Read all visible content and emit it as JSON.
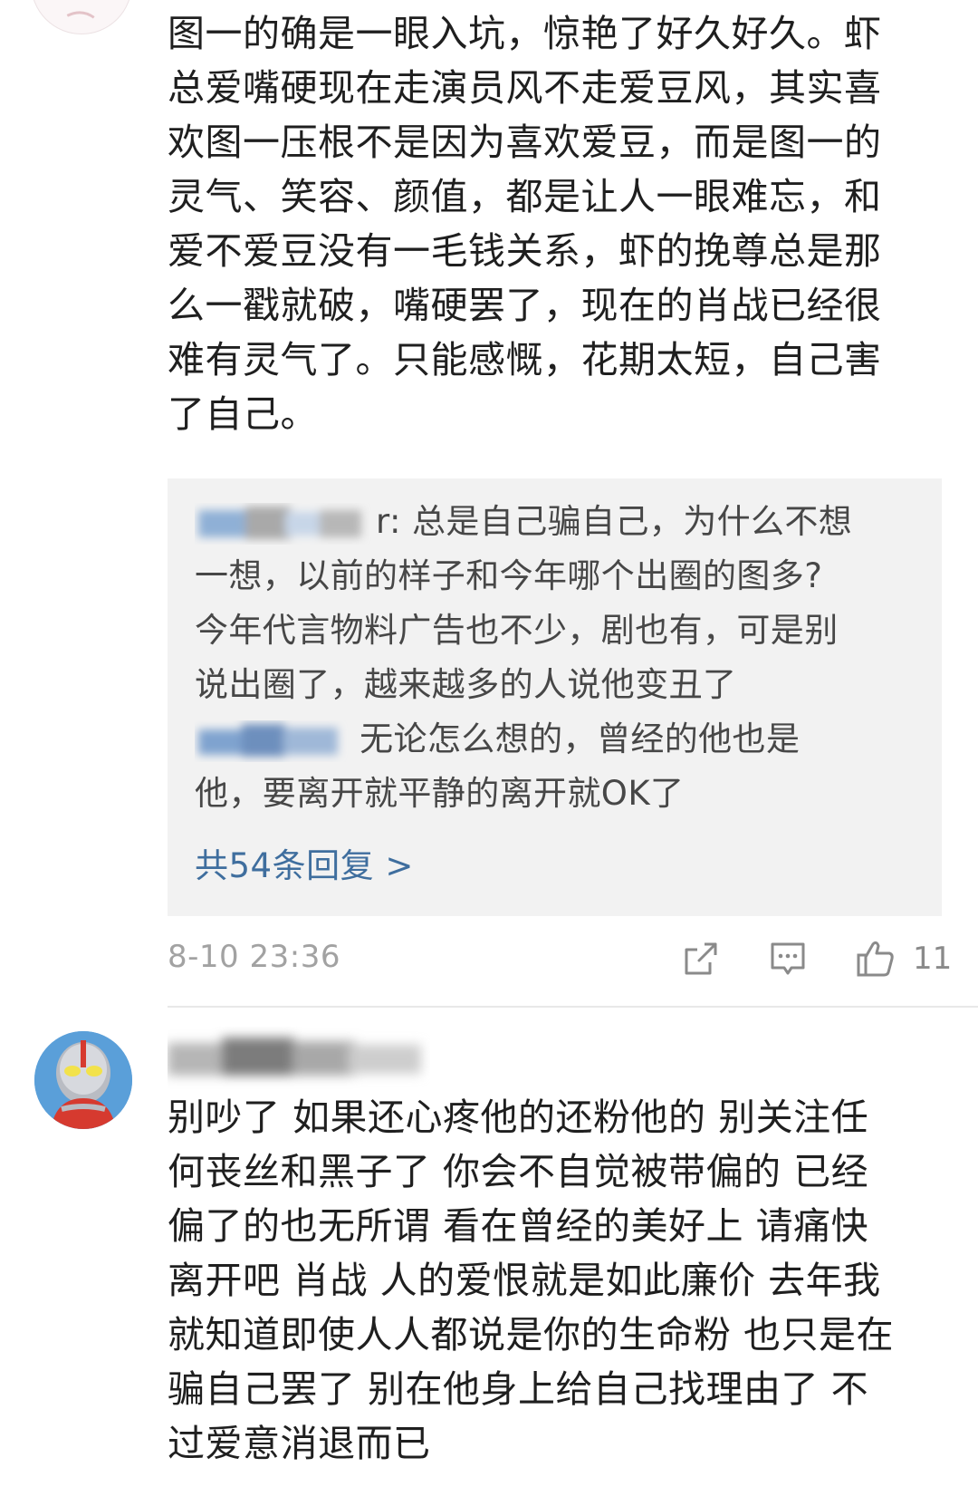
{
  "comment1": {
    "lines": [
      "图一的确是一眼入坑，惊艳了好久好久。虾",
      "总爱嘴硬现在走演员风不走爱豆风，其实喜",
      "欢图一压根不是因为喜欢爱豆，而是图一的",
      "灵气、笑容、颜值，都是让人一眼难忘，和",
      "爱不爱豆没有一毛钱关系，虾的挽尊总是那",
      "么一戳就破，嘴硬罢了，现在的肖战已经很",
      "难有灵气了。只能感慨，花期太短，自己害",
      "了自己。"
    ],
    "replies": [
      {
        "visible_name_tail": "r:",
        "lines": [
          " 总是自己骗自己，为什么不想",
          "一想，以前的样子和今年哪个出圈的图多?",
          "今年代言物料广告也不少，剧也有，可是别",
          "说出圈了，越来越多的人说他变丑了"
        ]
      },
      {
        "lines": [
          " 无论怎么想的，曾经的他也是",
          "他，要离开就平静的离开就OK了"
        ]
      }
    ],
    "more_replies": "共54条回复 >",
    "timestamp": "8-10 23:36",
    "like_count": "11"
  },
  "comment2": {
    "lines": [
      "别吵了 如果还心疼他的还粉他的 别关注任",
      "何丧丝和黑子了 你会不自觉被带偏的 已经",
      "偏了的也无所谓 看在曾经的美好上 请痛快",
      "离开吧  肖战 人的爱恨就是如此廉价 去年我",
      "就知道即使人人都说是你的生命粉 也只是在",
      "骗自己罢了 别在他身上给自己找理由了 不",
      "过爱意消退而已"
    ]
  },
  "icons": [
    "share-icon",
    "comment-icon",
    "like-icon"
  ],
  "colors": {
    "link": "#3f6e9e",
    "reply_bg": "#f2f2f2",
    "meta": "#a2a2a2"
  }
}
